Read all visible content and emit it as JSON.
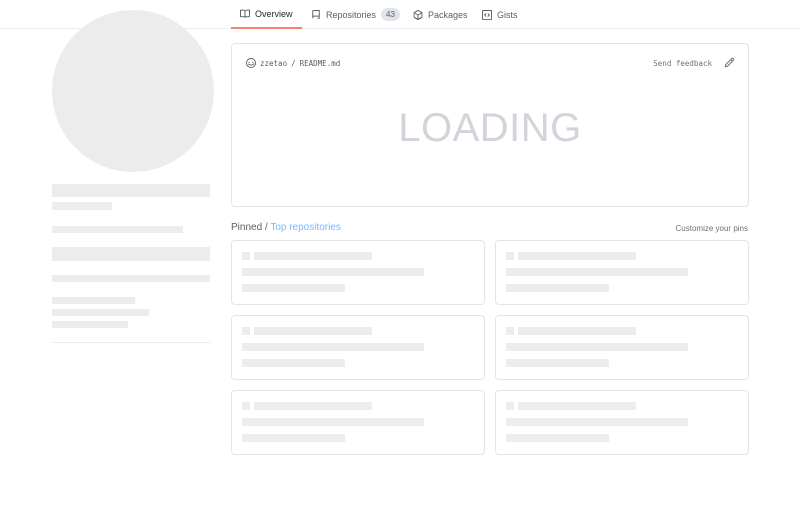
{
  "tabs": {
    "overview": {
      "label": "Overview"
    },
    "repositories": {
      "label": "Repositories",
      "count": "43"
    },
    "packages": {
      "label": "Packages"
    },
    "gists": {
      "label": "Gists"
    }
  },
  "readme": {
    "owner": "zzetao",
    "separator": "/",
    "file": "README.md",
    "feedback": "Send feedback",
    "loading": "LOADING"
  },
  "pinned": {
    "title": "Pinned",
    "separator": "/",
    "link": "Top repositories",
    "customize": "Customize your pins",
    "card_count": 6
  },
  "colors": {
    "selected_tab_underline": "#f9826c",
    "link": "#79b8ff",
    "skeleton": "#ececec",
    "border": "#e1e4e8"
  },
  "icons": {
    "overview": "book-icon",
    "repositories": "repo-icon",
    "packages": "package-icon",
    "gists": "code-square-icon",
    "readme": "smiley-icon",
    "edit": "pencil-icon"
  }
}
